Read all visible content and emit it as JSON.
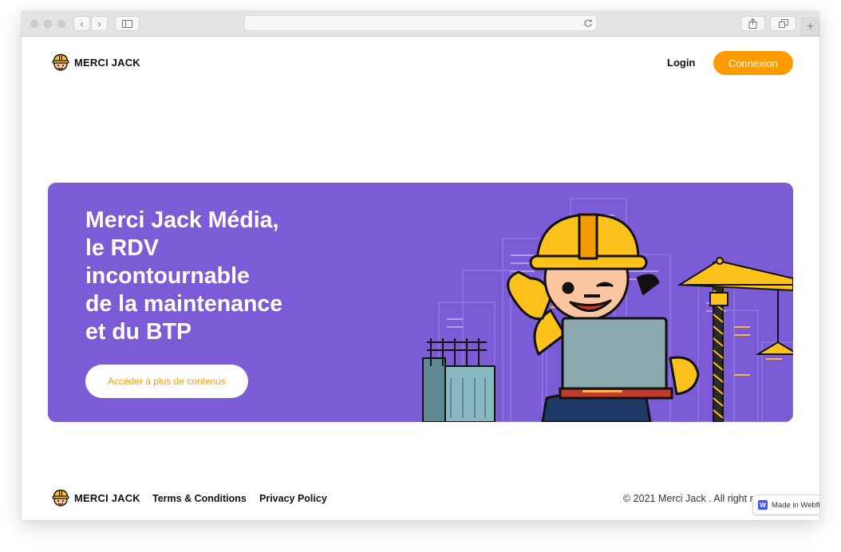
{
  "nav": {
    "brand": "MERCI JACK",
    "login": "Login",
    "connexion": "Connexion"
  },
  "hero": {
    "title_lines": [
      "Merci Jack Média,",
      "le RDV",
      "incontournable",
      "de la maintenance",
      "et du BTP"
    ],
    "button": "Accéder à plus de contenus"
  },
  "footer": {
    "brand": "MERCI JACK",
    "terms": "Terms & Conditions",
    "privacy": "Privacy Policy",
    "copyright": "© 2021 Merci Jack . All right r",
    "webflow_badge": "Made in Webflow"
  },
  "colors": {
    "accent": "#fe9b00",
    "hero_bg": "#7b5bd6"
  },
  "icons": {
    "back": "chevron-left-icon",
    "forward": "chevron-right-icon",
    "sidebar": "sidebar-icon",
    "reload": "reload-icon",
    "share": "share-icon",
    "tabs": "tabs-icon",
    "new_tab": "plus-icon",
    "brand_logo": "hardhat-logo-icon"
  }
}
